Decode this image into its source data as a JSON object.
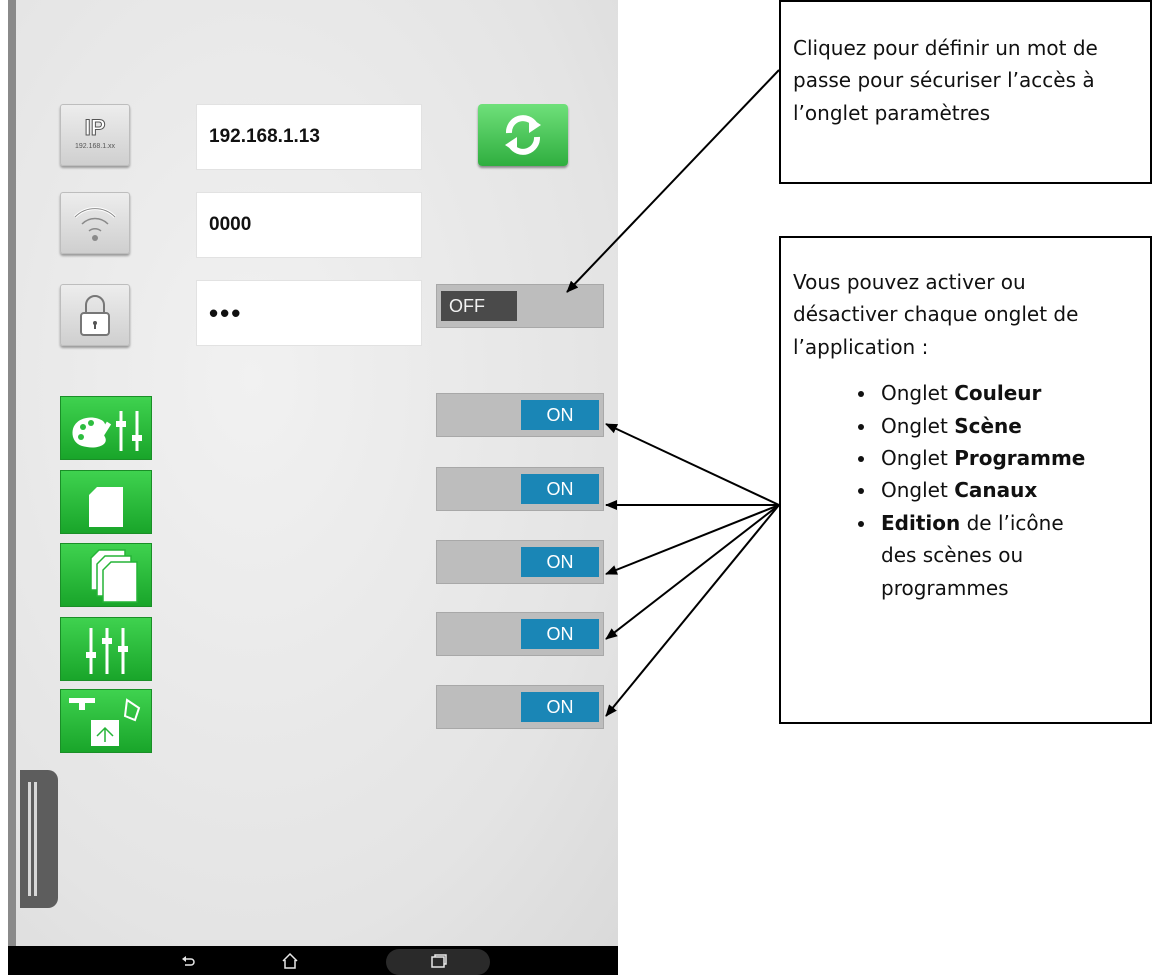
{
  "settings": {
    "ip_button": {
      "label": "IP",
      "sublabel": "192.168.1.xx"
    },
    "ip_value": "192.168.1.13",
    "wifi_value": "0000",
    "password_value": "•••",
    "password_toggle": "OFF",
    "tab_toggles": [
      "ON",
      "ON",
      "ON",
      "ON",
      "ON"
    ]
  },
  "callouts": {
    "password": "Cliquez pour définir un mot de passe pour sécuriser l’accès à l’onglet paramètres",
    "tabs_intro": "Vous pouvez activer ou désactiver chaque onglet de l’application :",
    "items": [
      {
        "prefix": "Onglet ",
        "bold": "Couleur",
        "suffix": ""
      },
      {
        "prefix": "Onglet ",
        "bold": "Scène",
        "suffix": ""
      },
      {
        "prefix": "Onglet ",
        "bold": "Programme",
        "suffix": ""
      },
      {
        "prefix": "Onglet ",
        "bold": "Canaux",
        "suffix": ""
      },
      {
        "prefix": "",
        "bold": "Edition",
        "suffix": " de l’icône des scènes ou programmes"
      }
    ]
  },
  "navbar": {
    "back_icon": "back-icon",
    "home_icon": "home-icon",
    "recents_icon": "recents-icon"
  },
  "colors": {
    "accent_green": "#2fbf42",
    "toggle_on": "#1a86b6",
    "toggle_off": "#4a4a4a"
  }
}
